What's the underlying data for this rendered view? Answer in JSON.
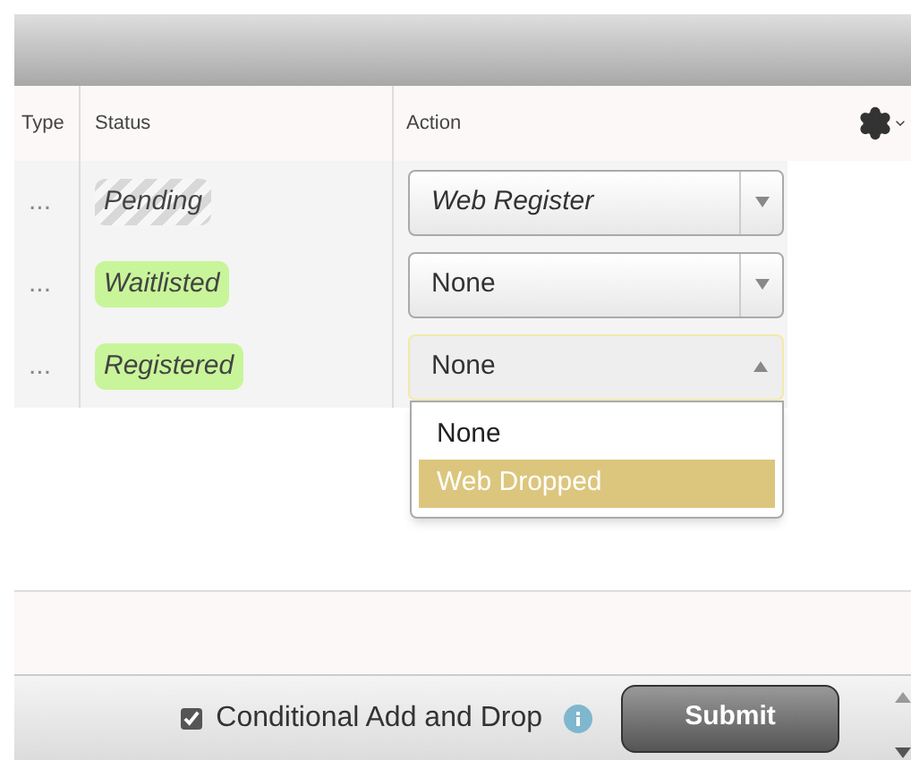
{
  "table": {
    "columns": [
      "Type",
      "Status",
      "Action"
    ],
    "rows": [
      {
        "column_1": "...",
        "status": "Pending",
        "kind": "pending",
        "action": "Web Register",
        "action_italic": true,
        "expanded": false
      },
      {
        "column_1": "...",
        "status": "Waitlisted",
        "kind": "done",
        "action": "None",
        "action_italic": false,
        "expanded": false
      },
      {
        "column_1": "...",
        "status": "Registered",
        "kind": "done",
        "action": "None",
        "action_italic": false,
        "expanded": true
      }
    ]
  },
  "dropdown": {
    "options": [
      {
        "label": "None",
        "selected": false
      },
      {
        "label": "Web Dropped",
        "selected": true
      }
    ]
  },
  "footer": {
    "conditional": {
      "label": "Conditional Add and Drop",
      "checked": true
    },
    "submit": "Submit"
  }
}
